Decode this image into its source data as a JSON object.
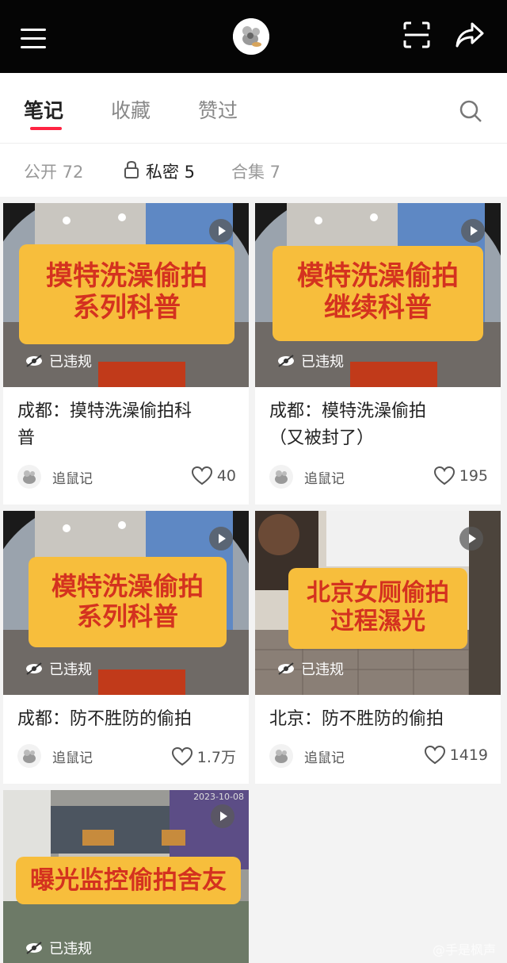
{
  "tabs": [
    {
      "label": "笔记",
      "active": true
    },
    {
      "label": "收藏",
      "active": false
    },
    {
      "label": "赞过",
      "active": false
    }
  ],
  "filters": [
    {
      "label": "公开 72",
      "active": false
    },
    {
      "label": "私密 5",
      "active": true
    },
    {
      "label": "合集 7",
      "active": false
    }
  ],
  "violation_label": "已违规",
  "accent_color": "#ff2442",
  "banner_color": "#f7be3c",
  "banner_text_color": "#d4321f",
  "notes": [
    {
      "banner_lines": [
        "摸特洗澡偷拍",
        "系列科普"
      ],
      "title_lines": [
        "成都：摸特洗澡偷拍科",
        "普"
      ],
      "author": "追鼠记",
      "likes": "40"
    },
    {
      "banner_lines": [
        "模特洗澡偷拍",
        "继续科普"
      ],
      "title_lines": [
        "成都：模特洗澡偷拍",
        "（又被封了）"
      ],
      "author": "追鼠记",
      "likes": "195"
    },
    {
      "banner_lines": [
        "模特洗澡偷拍",
        "系列科普"
      ],
      "title_lines": [
        "成都：防不胜防的偷拍"
      ],
      "author": "追鼠记",
      "likes": "1.7万"
    },
    {
      "banner_lines": [
        "北京女厕偷拍",
        "过程濕光"
      ],
      "title_lines": [
        "北京：防不胜防的偷拍"
      ],
      "author": "追鼠记",
      "likes": "1419"
    },
    {
      "banner_lines": [
        "曝光监控偷拍舍友"
      ],
      "timestamp": "2023-10-08",
      "title_lines": [],
      "author": "",
      "likes": ""
    }
  ],
  "watermark": "@手是枫声"
}
